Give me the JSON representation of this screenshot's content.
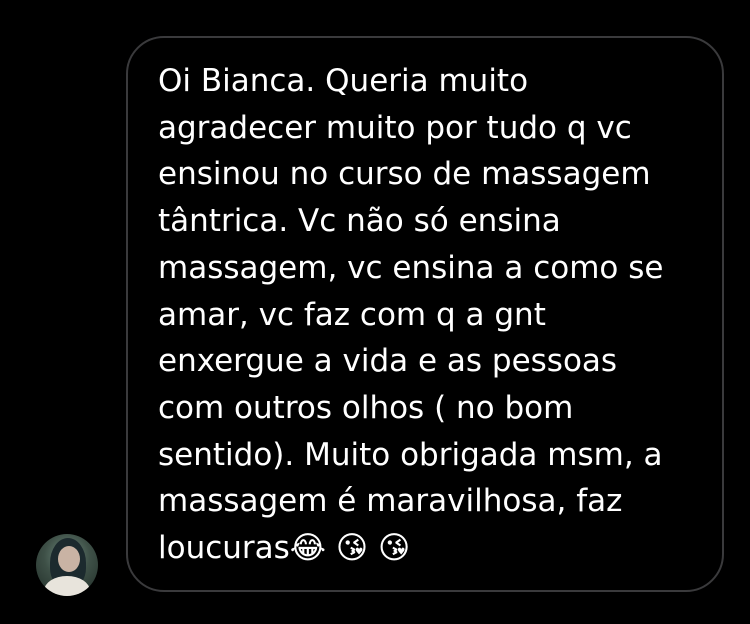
{
  "conversation": {
    "message": {
      "text": "Oi Bianca. Queria muito\nagradecer muito por tudo q vc\nensinou no curso de massagem\ntântrica. Vc não só ensina\nmassagem, vc ensina a como se\namar, vc faz com q a gnt\nenxergue a vida e as pessoas\ncom outros olhos ( no bom\nsentido). Muito obrigada msm, a\nmassagem é maravilhosa, faz\nloucuras😂 😘 😘"
    },
    "sender": {
      "avatar_icon": "user-avatar-photo"
    },
    "colors": {
      "background": "#000000",
      "bubble_border": "#3a3a3c",
      "text": "#ffffff"
    }
  }
}
